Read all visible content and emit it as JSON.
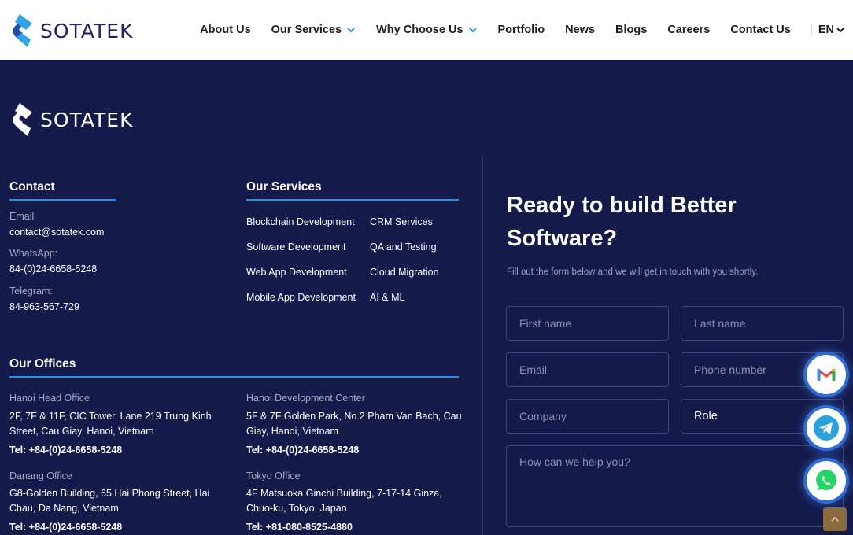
{
  "brand": {
    "name": "SOTATEK"
  },
  "nav": {
    "items": [
      {
        "label": "About Us",
        "has_dropdown": false
      },
      {
        "label": "Our Services",
        "has_dropdown": true
      },
      {
        "label": "Why Choose Us",
        "has_dropdown": true
      },
      {
        "label": "Portfolio",
        "has_dropdown": false
      },
      {
        "label": "News",
        "has_dropdown": false
      },
      {
        "label": "Blogs",
        "has_dropdown": false
      },
      {
        "label": "Careers",
        "has_dropdown": false
      },
      {
        "label": "Contact Us",
        "has_dropdown": false
      }
    ],
    "language": "EN"
  },
  "contact": {
    "heading": "Contact",
    "email_label": "Email",
    "email": "contact@sotatek.com",
    "whatsapp_label": "WhatsApp:",
    "whatsapp": "84-(0)24-6658-5248",
    "telegram_label": "Telegram:",
    "telegram": "84-963-567-729"
  },
  "services": {
    "heading": "Our Services",
    "left": [
      "Blockchain Development",
      "Software Development",
      "Web App Development",
      "Mobile App Development"
    ],
    "right": [
      "CRM Services",
      "QA and Testing",
      "Cloud Migration",
      "AI & ML"
    ]
  },
  "offices": {
    "heading": "Our Offices",
    "list": [
      {
        "name": "Hanoi Head Office",
        "address_1": "2F, 7F & 11F, CIC Tower, Lane 219 Trung Kinh",
        "address_2": "Street, Cau Giay, Hanoi, Vietnam",
        "tel": "Tel: +84-(0)24-6658-5248"
      },
      {
        "name": "Hanoi Development Center",
        "address_1": "5F & 7F Golden Park, No.2 Pham Van Bach, Cau",
        "address_2": "Giay, Hanoi, Vietnam",
        "tel": "Tel: +84-(0)24-6658-5248"
      },
      {
        "name": "Danang Office",
        "address_1": "G8-Golden Building, 65 Hai Phong Street, Hai",
        "address_2": "Chau, Da Nang, Vietnam",
        "tel": "Tel: +84-(0)24-6658-5248"
      },
      {
        "name": "Tokyo Office",
        "address_1": "4F Matsuoka Ginchi Building, 7-17-14 Ginza,",
        "address_2": "Chuo-ku, Tokyo, Japan",
        "tel": "Tel: +81-080-8525-4880"
      }
    ]
  },
  "cta": {
    "title_line_1": "Ready to build Better",
    "title_line_2": "Software?",
    "subtitle": "Fill out the form below and we will get in touch with you shortly."
  },
  "form": {
    "first_name_placeholder": "First name",
    "last_name_placeholder": "Last name",
    "email_placeholder": "Email",
    "phone_placeholder": "Phone number",
    "company_placeholder": "Company",
    "role_value": "Role",
    "message_placeholder": "How can we help you?"
  },
  "floating": {
    "icons": [
      "gmail-icon",
      "telegram-icon",
      "whatsapp-icon"
    ]
  },
  "colors": {
    "background": "#141a4a",
    "accent": "#2a8fe0",
    "header_bg": "#ffffff"
  }
}
